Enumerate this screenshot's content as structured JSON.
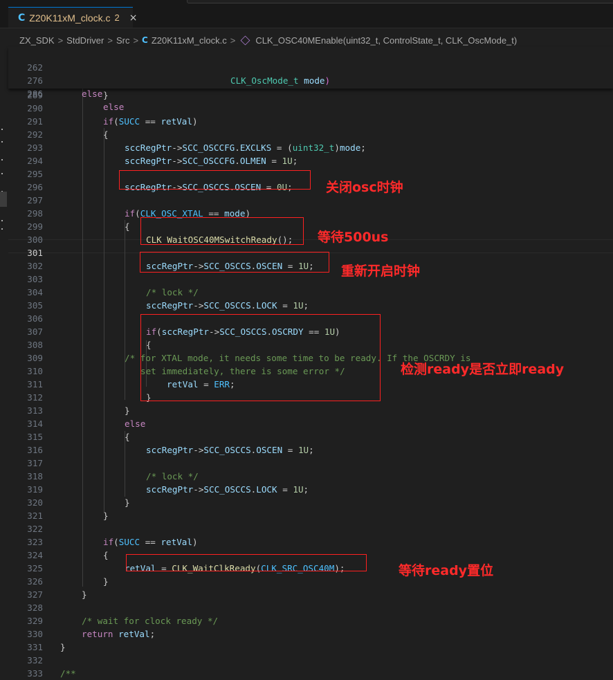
{
  "tab": {
    "icon": "c-file-icon",
    "lang_letter": "C",
    "filename": "Z20K11xM_clock.c",
    "problems": "2",
    "close": "×"
  },
  "breadcrumb": {
    "items": [
      "ZX_SDK",
      "StdDriver",
      "Src"
    ],
    "file_letter": "C",
    "file": "Z20K11xM_clock.c",
    "symbol": "CLK_OSC40MEnable(uint32_t, ControlState_t, CLK_OscMode_t)",
    "sep": ">"
  },
  "sticky": [
    {
      "ln": "262",
      "code": "CLK_OscMode_t mode)"
    },
    {
      "ln": "276",
      "code": "else"
    },
    {
      "ln": "286",
      "code": "else"
    }
  ],
  "lines": [
    {
      "ln": "289",
      "code": "}"
    },
    {
      "ln": "290",
      "code": ""
    },
    {
      "ln": "291",
      "code": "if(SUCC == retVal)"
    },
    {
      "ln": "292",
      "code": "{"
    },
    {
      "ln": "293",
      "code": "sccRegPtr->SCC_OSCCFG.EXCLKS = (uint32_t)mode;"
    },
    {
      "ln": "294",
      "code": "sccRegPtr->SCC_OSCCFG.OLMEN = 1U;"
    },
    {
      "ln": "295",
      "code": ""
    },
    {
      "ln": "296",
      "code": "sccRegPtr->SCC_OSCCS.OSCEN = 0U;"
    },
    {
      "ln": "297",
      "code": ""
    },
    {
      "ln": "298",
      "code": "if(CLK_OSC_XTAL == mode)"
    },
    {
      "ln": "299",
      "code": "{"
    },
    {
      "ln": "300",
      "code": "CLK_WaitOSC40MSwitchReady();"
    },
    {
      "ln": "301",
      "code": ""
    },
    {
      "ln": "302",
      "code": "sccRegPtr->SCC_OSCCS.OSCEN = 1U;"
    },
    {
      "ln": "303",
      "code": ""
    },
    {
      "ln": "304",
      "code": "/* lock */"
    },
    {
      "ln": "305",
      "code": "sccRegPtr->SCC_OSCCS.LOCK = 1U;"
    },
    {
      "ln": "306",
      "code": ""
    },
    {
      "ln": "307",
      "code": "if(sccRegPtr->SCC_OSCCS.OSCRDY == 1U)"
    },
    {
      "ln": "308",
      "code": "{"
    },
    {
      "ln": "309",
      "code": "/* for XTAL mode, it needs some time to be ready. If the OSCRDY is"
    },
    {
      "ln": "310",
      "code": "set immediately, there is some error */"
    },
    {
      "ln": "311",
      "code": "retVal = ERR;"
    },
    {
      "ln": "312",
      "code": "}"
    },
    {
      "ln": "313",
      "code": "}"
    },
    {
      "ln": "314",
      "code": "else"
    },
    {
      "ln": "315",
      "code": "{"
    },
    {
      "ln": "316",
      "code": "sccRegPtr->SCC_OSCCS.OSCEN = 1U;"
    },
    {
      "ln": "317",
      "code": ""
    },
    {
      "ln": "318",
      "code": "/* lock */"
    },
    {
      "ln": "319",
      "code": "sccRegPtr->SCC_OSCCS.LOCK = 1U;"
    },
    {
      "ln": "320",
      "code": "}"
    },
    {
      "ln": "321",
      "code": "}"
    },
    {
      "ln": "322",
      "code": ""
    },
    {
      "ln": "323",
      "code": "if(SUCC == retVal)"
    },
    {
      "ln": "324",
      "code": "{"
    },
    {
      "ln": "325",
      "code": "retVal = CLK_WaitClkReady(CLK_SRC_OSC40M);"
    },
    {
      "ln": "326",
      "code": "}"
    },
    {
      "ln": "327",
      "code": "}"
    },
    {
      "ln": "328",
      "code": ""
    },
    {
      "ln": "329",
      "code": "/* wait for clock ready */"
    },
    {
      "ln": "330",
      "code": "return retVal;"
    },
    {
      "ln": "331",
      "code": "}"
    },
    {
      "ln": "332",
      "code": ""
    },
    {
      "ln": "333",
      "code": "/**"
    }
  ],
  "annotations": [
    "关闭osc时钟",
    "等待500us",
    "重新开启时钟",
    "检测ready是否立即ready",
    "等待ready置位"
  ],
  "colors": {
    "annotation": "#ff2020",
    "keyword": "#c586c0",
    "function": "#dcdcaa",
    "variable": "#9cdcfe",
    "comment": "#6a9955"
  }
}
